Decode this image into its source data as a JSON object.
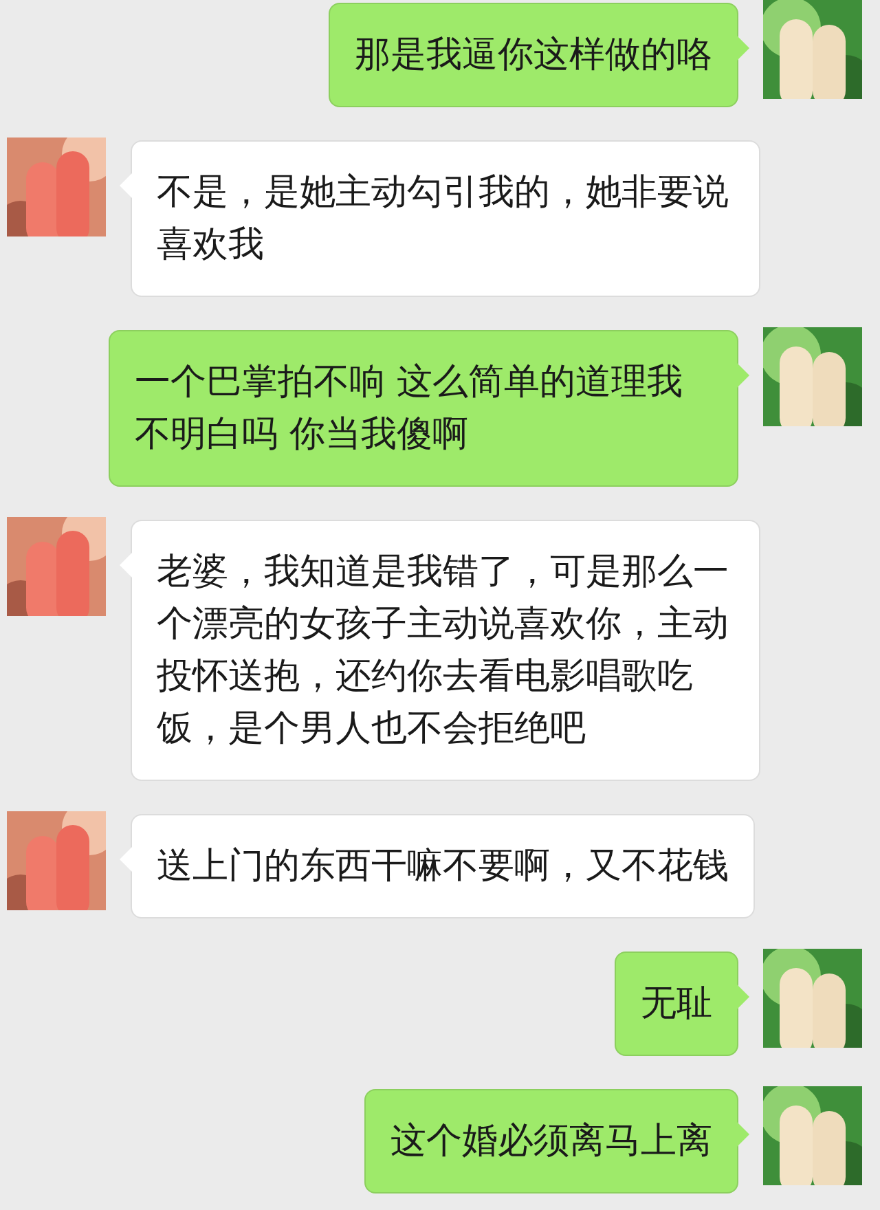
{
  "messages": [
    {
      "kind": "outgoing",
      "text": "那是我逼你这样做的咯"
    },
    {
      "kind": "incoming",
      "text": "不是，是她主动勾引我的，她非要说喜欢我"
    },
    {
      "kind": "outgoing",
      "text": "一个巴掌拍不响 这么简单的道理我不明白吗 你当我傻啊"
    },
    {
      "kind": "incoming",
      "text": "老婆，我知道是我错了，可是那么一个漂亮的女孩子主动说喜欢你，主动投怀送抱，还约你去看电影唱歌吃饭，是个男人也不会拒绝吧"
    },
    {
      "kind": "incoming",
      "text": "送上门的东西干嘛不要啊，又不花钱"
    },
    {
      "kind": "outgoing",
      "text": "无耻"
    },
    {
      "kind": "outgoing",
      "text": "这个婚必须离马上离"
    }
  ]
}
